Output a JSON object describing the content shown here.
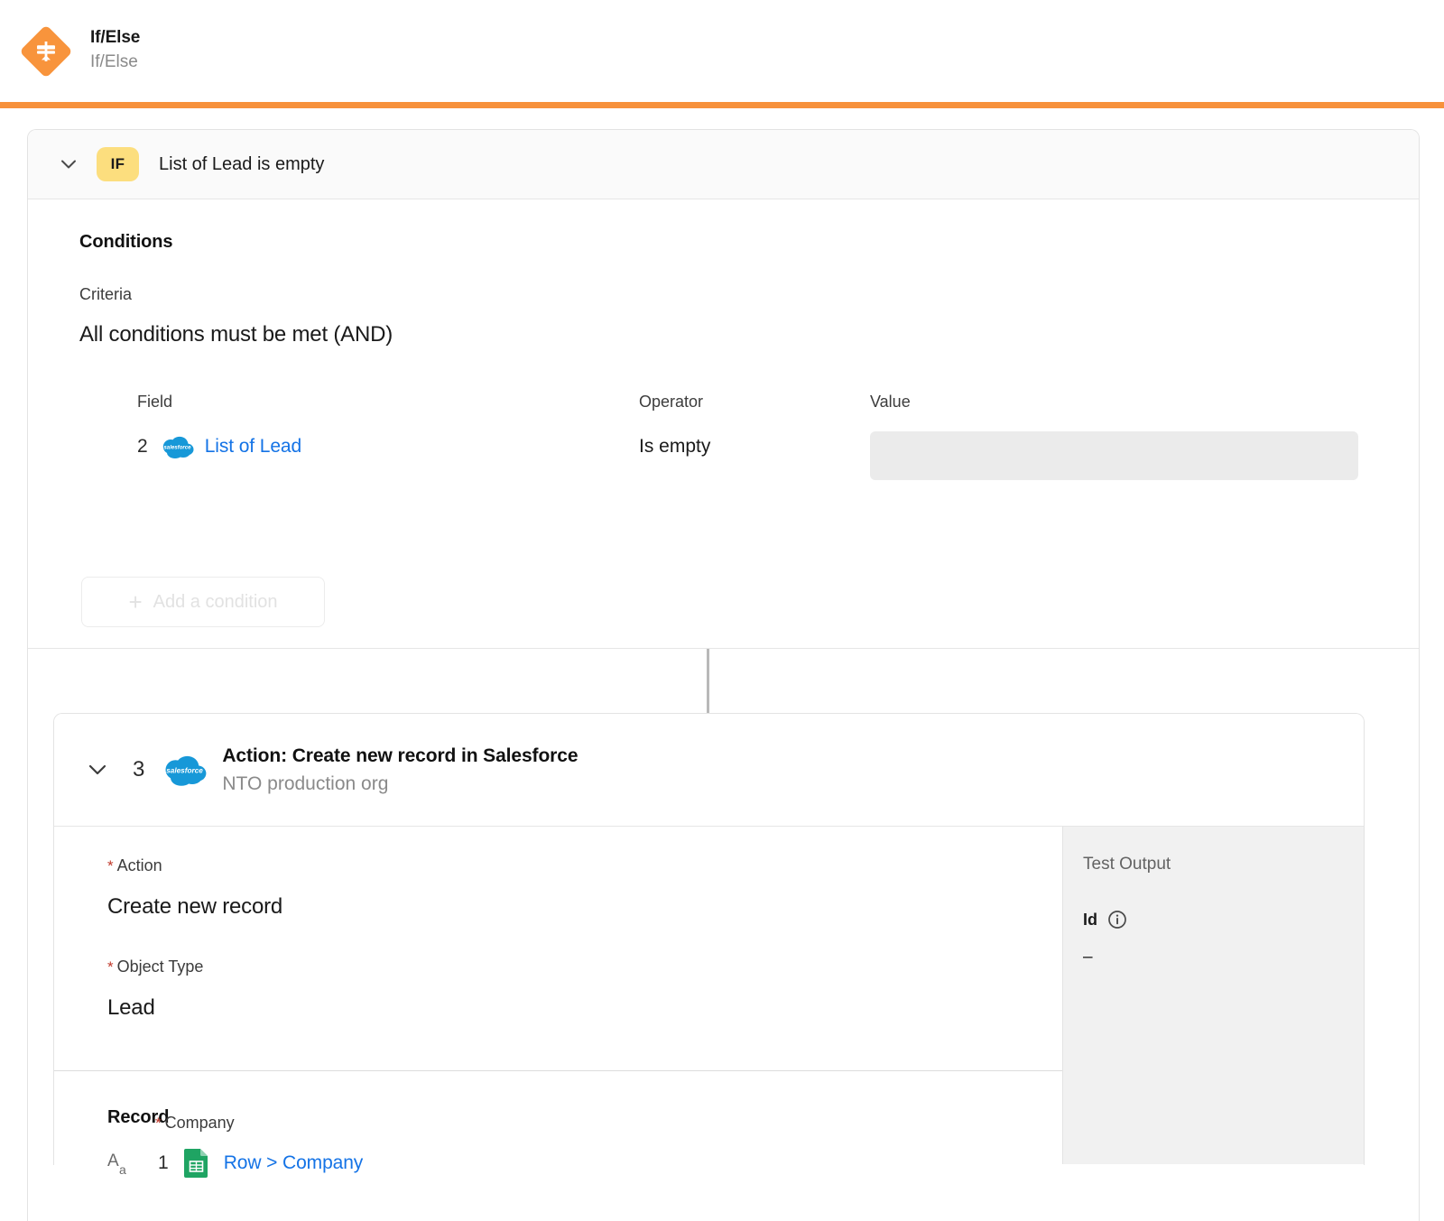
{
  "header": {
    "title": "If/Else",
    "subtitle": "If/Else",
    "icon": "ifelse-signpost-icon",
    "accent_color": "#F7913B"
  },
  "if_block": {
    "chevron_icon": "chevron-down-icon",
    "badge": "IF",
    "badge_color": "#FCDE7E",
    "summary": "List of Lead is empty",
    "conditions_title": "Conditions",
    "criteria_label": "Criteria",
    "criteria_value": "All conditions must be met (AND)",
    "columns": {
      "field": "Field",
      "operator": "Operator",
      "value": "Value"
    },
    "rows": [
      {
        "number": "2",
        "source_icon": "salesforce-cloud-icon",
        "field": "List of Lead",
        "operator": "Is empty",
        "value": "",
        "value_placeholder": ""
      }
    ],
    "add_condition_label": "Add a condition",
    "add_condition_icon": "plus-icon"
  },
  "action": {
    "chevron_icon": "chevron-down-icon",
    "number": "3",
    "app_icon": "salesforce-cloud-icon",
    "title": "Action: Create new record in Salesforce",
    "subtitle": "NTO production org",
    "fields": [
      {
        "label": "Action",
        "required": true,
        "value": "Create new record"
      },
      {
        "label": "Object Type",
        "required": true,
        "value": "Lead"
      }
    ],
    "record_section_title": "Record",
    "record_field": {
      "label": "Company",
      "required": true,
      "type_icon": "text-type-aa-icon",
      "number": "1",
      "source_icon": "google-sheets-icon",
      "value": "Row > Company"
    }
  },
  "test_output": {
    "title": "Test Output",
    "info_icon": "info-circle-icon",
    "entries": [
      {
        "key": "Id",
        "value": "–"
      }
    ]
  }
}
